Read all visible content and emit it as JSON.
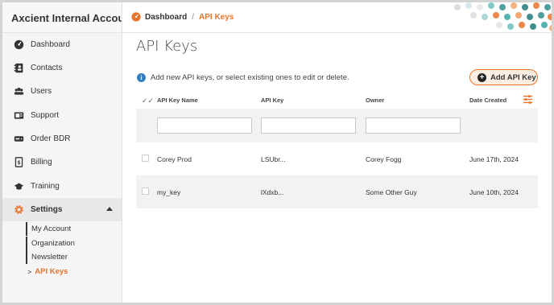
{
  "app": {
    "title": "Axcient Internal Accou..."
  },
  "breadcrumb": {
    "home": "Dashboard",
    "separator": "/",
    "current": "API Keys"
  },
  "sidebar": {
    "items": [
      {
        "label": "Dashboard",
        "icon": "dashboard-icon"
      },
      {
        "label": "Contacts",
        "icon": "contacts-icon"
      },
      {
        "label": "Users",
        "icon": "users-icon"
      },
      {
        "label": "Support",
        "icon": "support-icon"
      },
      {
        "label": "Order BDR",
        "icon": "order-icon"
      },
      {
        "label": "Billing",
        "icon": "billing-icon"
      },
      {
        "label": "Training",
        "icon": "training-icon"
      },
      {
        "label": "Settings",
        "icon": "gear-icon"
      }
    ],
    "settings_sub": [
      {
        "label": "My Account"
      },
      {
        "label": "Organization"
      },
      {
        "label": "Newsletter"
      },
      {
        "label": "API Keys"
      }
    ]
  },
  "page": {
    "title": "API Keys",
    "info_text": "Add new API keys, or select existing ones to edit or delete.",
    "add_button": "Add API Key"
  },
  "table": {
    "columns": [
      "API Key Name",
      "API Key",
      "Owner",
      "Date Created"
    ],
    "rows": [
      {
        "name": "Corey Prod",
        "key": "LSUbr...",
        "owner": "Corey Fogg",
        "date": "June 17th, 2024"
      },
      {
        "name": "my_key",
        "key": "lXdxb...",
        "owner": "Some Other Guy",
        "date": "June 10th, 2024"
      }
    ]
  },
  "colors": {
    "accent": "#e8732b",
    "info": "#2f7fc1"
  }
}
